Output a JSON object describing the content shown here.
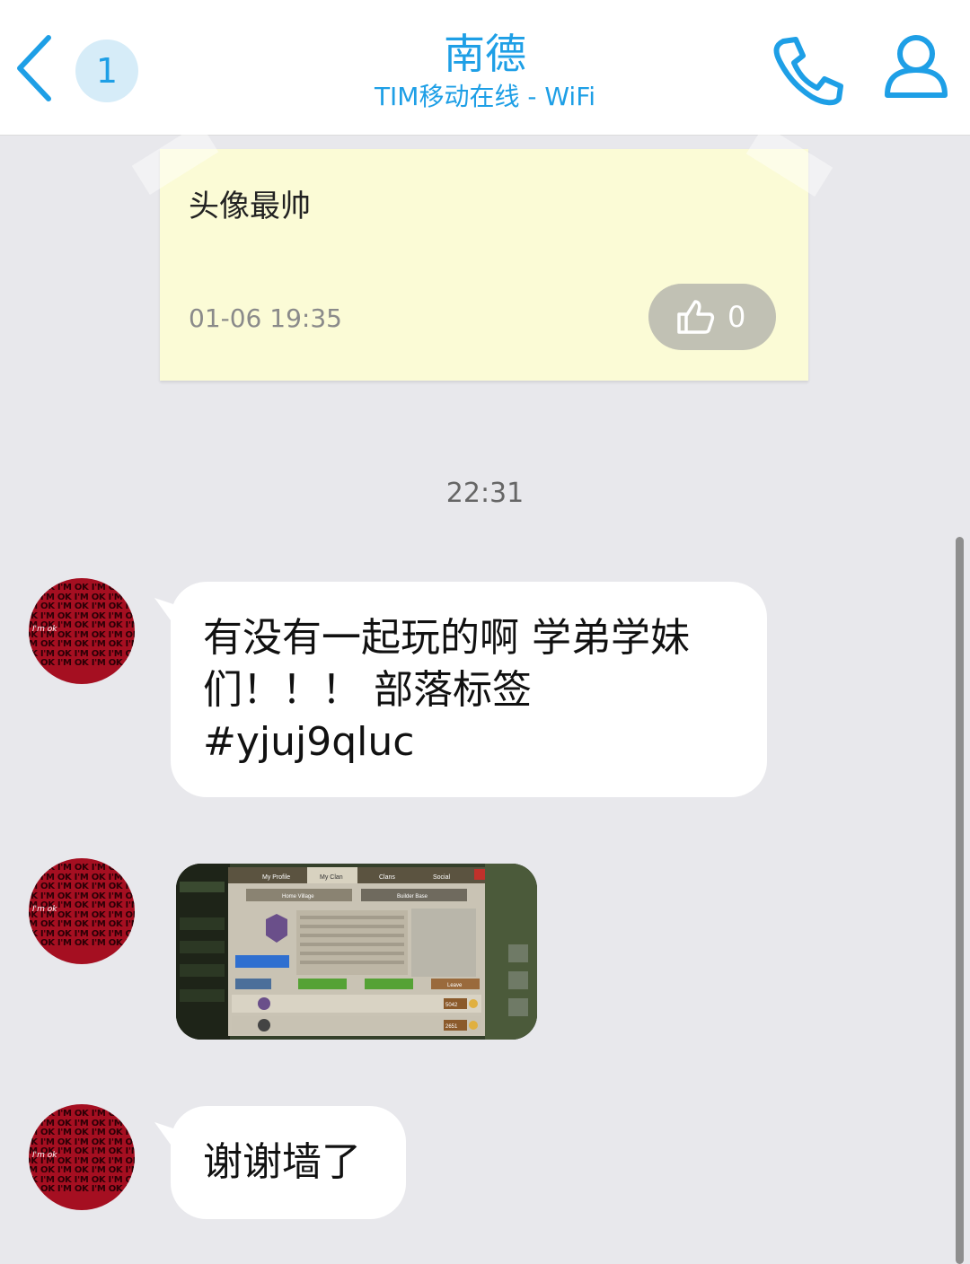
{
  "header": {
    "back_label": "back",
    "unread_count": "1",
    "contact_name": "南德",
    "status": "TIM移动在线 - WiFi",
    "call_icon": "phone-icon",
    "profile_icon": "person-icon",
    "accent_color": "#1e9fe6"
  },
  "note_card": {
    "text": "头像最帅",
    "timestamp": "01-06 19:35",
    "like_count": "0",
    "like_icon": "thumbs-up-icon"
  },
  "time_separator": "22:31",
  "messages": [
    {
      "type": "text",
      "lines": [
        "有没有一起玩的啊 学弟学妹",
        "们！！！ 部落标签",
        "#yjuj9qluc"
      ]
    },
    {
      "type": "image"
    },
    {
      "type": "text",
      "text": "谢谢墙了"
    }
  ],
  "avatar": {
    "pattern_text": "I'M OK I'M OK I'M OK I'M OK I'M OK I'M OK I'M OK I'M OK I'M OK I'M OK I'M OK I'M OK I'M OK I'M OK I'M OK I'M OK I'M OK I'M OK I'M OK I'M OK I'M OK I'M OK I'M OK I'M OK I'M OK I'M OK I'M OK I'M OK I'M OK I'M OK I'M OK I'M OK",
    "signature": "I'm ok"
  },
  "screenshot_tabs": [
    "My Profile",
    "My Clan",
    "Clans",
    "Social"
  ],
  "screenshot_buttons": [
    "Home Village",
    "Builder Base",
    "Leave"
  ],
  "screenshot_scores": [
    "5042",
    "2651"
  ]
}
